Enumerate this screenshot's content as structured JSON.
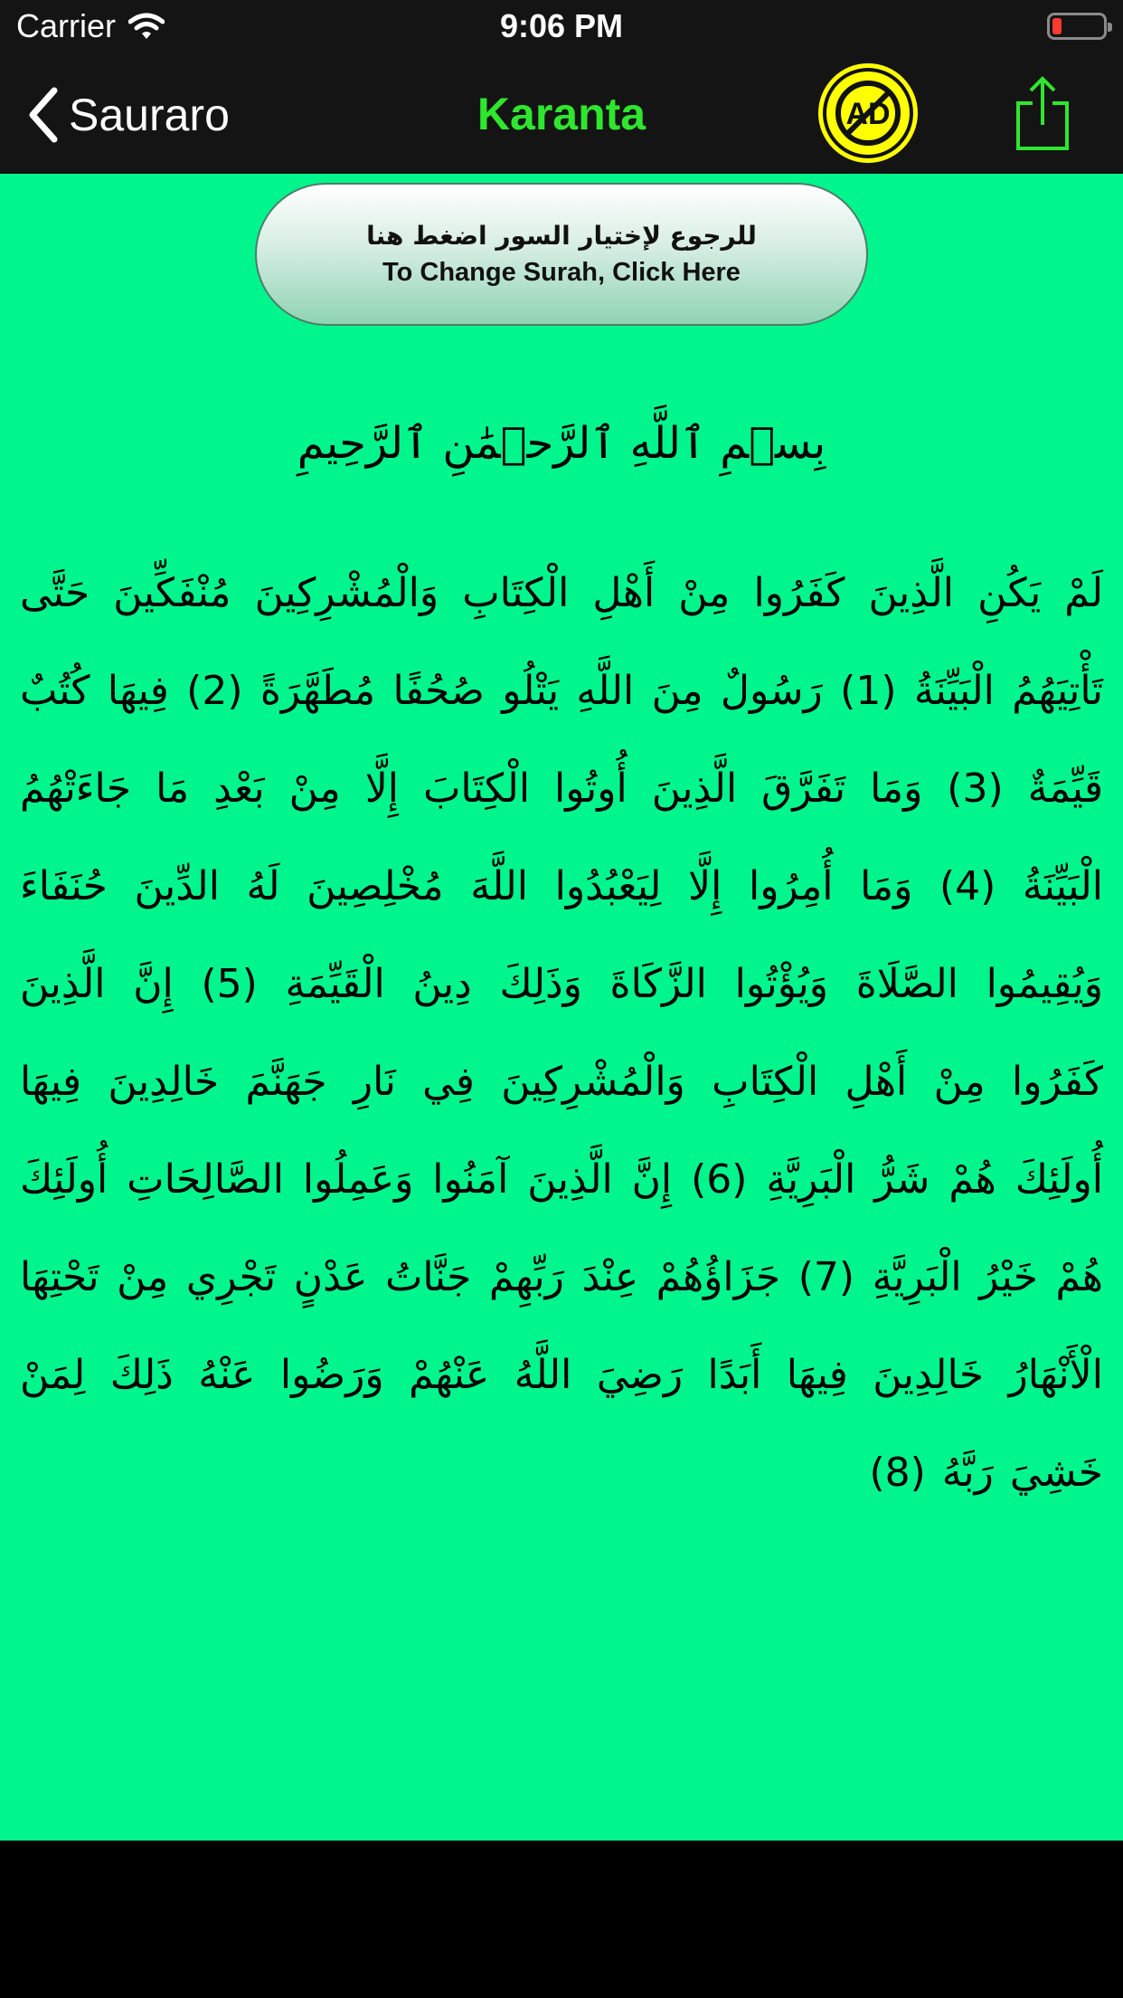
{
  "status_bar": {
    "carrier": "Carrier",
    "time": "9:06 PM",
    "battery_color": "#ff3b30"
  },
  "nav": {
    "back_label": "Sauraro",
    "title": "Karanta",
    "title_color": "#2ee62e",
    "ad_label": "AD",
    "icons": [
      "chevron-left-icon",
      "no-ads-icon",
      "share-icon"
    ]
  },
  "content": {
    "background": "#00f58c",
    "change_surah_arabic": "للرجوع لإختيار السور اضغط هنا",
    "change_surah_english": "To Change Surah, Click Here",
    "basmala": "بِسۡمِ ٱللَّهِ ٱلرَّحۡمَٰنِ ٱلرَّحِيمِ",
    "surah_text": "لَمْ يَكُنِ الَّذِينَ كَفَرُوا مِنْ أَهْلِ الْكِتَابِ وَالْمُشْرِكِينَ مُنْفَكِّينَ حَتَّى تَأْتِيَهُمُ الْبَيِّنَةُ (1) رَسُولٌ مِنَ اللَّهِ يَتْلُو صُحُفًا مُطَهَّرَةً (2) فِيهَا كُتُبٌ قَيِّمَةٌ (3) وَمَا تَفَرَّقَ الَّذِينَ أُوتُوا الْكِتَابَ إِلَّا مِنْ بَعْدِ مَا جَاءَتْهُمُ الْبَيِّنَةُ (4) وَمَا أُمِرُوا إِلَّا لِيَعْبُدُوا اللَّهَ مُخْلِصِينَ لَهُ الدِّينَ حُنَفَاءَ وَيُقِيمُوا الصَّلَاةَ وَيُؤْتُوا الزَّكَاةَ وَذَلِكَ دِينُ الْقَيِّمَةِ (5) إِنَّ الَّذِينَ كَفَرُوا مِنْ أَهْلِ الْكِتَابِ وَالْمُشْرِكِينَ فِي نَارِ جَهَنَّمَ خَالِدِينَ فِيهَا أُولَئِكَ هُمْ شَرُّ الْبَرِيَّةِ (6) إِنَّ الَّذِينَ آمَنُوا وَعَمِلُوا الصَّالِحَاتِ أُولَئِكَ هُمْ خَيْرُ الْبَرِيَّةِ (7) جَزَاؤُهُمْ عِنْدَ رَبِّهِمْ جَنَّاتُ عَدْنٍ تَجْرِي مِنْ تَحْتِهَا الْأَنْهَارُ خَالِدِينَ فِيهَا أَبَدًا رَضِيَ اللَّهُ عَنْهُمْ وَرَضُوا عَنْهُ ذَلِكَ لِمَنْ خَشِيَ رَبَّهُ (8)"
  }
}
